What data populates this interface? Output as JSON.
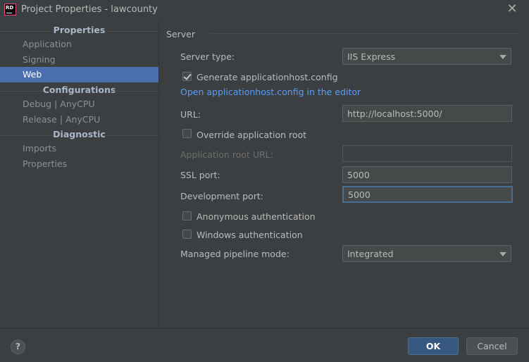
{
  "window": {
    "icon_text": "RD",
    "title": "Project Properties - lawcounty"
  },
  "sidebar": {
    "groups": [
      {
        "header": "Properties",
        "items": [
          "Application",
          "Signing",
          "Web"
        ]
      },
      {
        "header": "Configurations",
        "items": [
          "Debug | AnyCPU",
          "Release | AnyCPU"
        ]
      },
      {
        "header": "Diagnostic",
        "items": [
          "Imports",
          "Properties"
        ]
      }
    ],
    "selected": "Web"
  },
  "server": {
    "section_title": "Server",
    "server_type_label": "Server type:",
    "server_type_value": "IIS Express",
    "generate_config_label": "Generate applicationhost.config",
    "generate_config_checked": true,
    "open_config_link": "Open applicationhost.config in the editor",
    "url_label": "URL:",
    "url_value": "http://localhost:5000/",
    "override_root_label": "Override application root",
    "override_root_checked": false,
    "app_root_url_label": "Application root URL:",
    "app_root_url_value": "",
    "ssl_port_label": "SSL port:",
    "ssl_port_value": "5000",
    "dev_port_label": "Development port:",
    "dev_port_value": "5000",
    "anon_auth_label": "Anonymous authentication",
    "anon_auth_checked": false,
    "windows_auth_label": "Windows authentication",
    "windows_auth_checked": false,
    "pipeline_label": "Managed pipeline mode:",
    "pipeline_value": "Integrated"
  },
  "footer": {
    "help_label": "?",
    "ok_label": "OK",
    "cancel_label": "Cancel"
  },
  "colors": {
    "background": "#3c3f41",
    "selection": "#4b6eaf",
    "link": "#589df6",
    "ok_button": "#365880"
  }
}
